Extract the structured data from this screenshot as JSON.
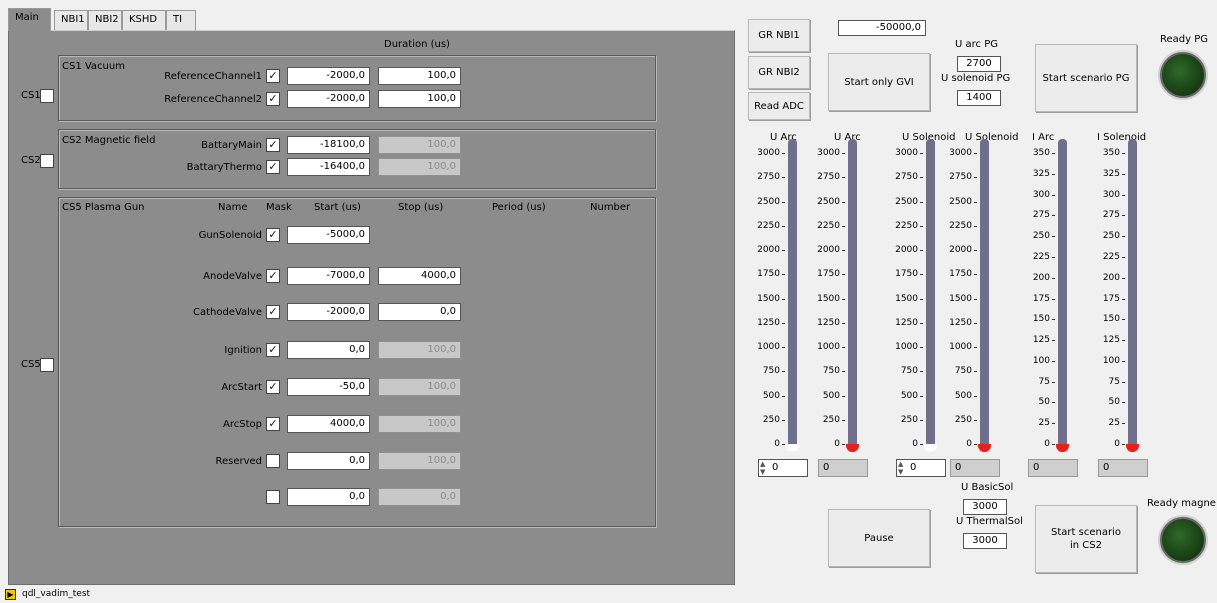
{
  "tabs": [
    "Main",
    "NBI1",
    "NBI2",
    "KSHD",
    "TI"
  ],
  "main": {
    "duration_header": "Duration (us)",
    "cs1": {
      "side_label": "CS1",
      "title": "CS1 Vacuum",
      "rows": [
        {
          "name": "ReferenceChannel1",
          "checked": "✓",
          "value": "-2000,0",
          "duration": "100,0"
        },
        {
          "name": "ReferenceChannel2",
          "checked": "✓",
          "value": "-2000,0",
          "duration": "100,0"
        }
      ]
    },
    "cs2": {
      "side_label": "CS2",
      "title": "CS2 Magnetic field",
      "rows": [
        {
          "name": "BattaryMain",
          "checked": "✓",
          "value": "-18100,0",
          "duration": "100,0"
        },
        {
          "name": "BattaryThermo",
          "checked": "✓",
          "value": "-16400,0",
          "duration": "100,0"
        }
      ]
    },
    "cs5": {
      "side_label": "CS5",
      "title": "CS5 Plasma Gun",
      "headers": {
        "name": "Name",
        "mask": "Mask",
        "start": "Start (us)",
        "stop": "Stop (us)",
        "period": "Period (us)",
        "number": "Number"
      },
      "rows": [
        {
          "name": "GunSolenoid",
          "checked": "✓",
          "start": "-5000,0",
          "stop": ""
        },
        {
          "name": "AnodeValve",
          "checked": "✓",
          "start": "-7000,0",
          "stop": "4000,0"
        },
        {
          "name": "CathodeValve",
          "checked": "✓",
          "start": "-2000,0",
          "stop": "0,0"
        },
        {
          "name": "Ignition",
          "checked": "✓",
          "start": "0,0",
          "stop": "100,0"
        },
        {
          "name": "ArcStart",
          "checked": "✓",
          "start": "-50,0",
          "stop": "100,0"
        },
        {
          "name": "ArcStop",
          "checked": "✓",
          "start": "4000,0",
          "stop": "100,0"
        },
        {
          "name": "Reserved",
          "checked": "",
          "start": "0,0",
          "stop": "100,0"
        },
        {
          "name": "",
          "checked": "",
          "start": "0,0",
          "stop": "0,0"
        }
      ]
    }
  },
  "right": {
    "gr_nbi1": "GR NBI1",
    "gr_nbi2": "GR NBI2",
    "read_adc": "Read ADC",
    "top_value": "-50000,0",
    "start_only_gvi": "Start only GVI",
    "u_arc_pg_label": "U arc PG",
    "u_arc_pg_value": "2700",
    "u_solenoid_pg_label": "U solenoid PG",
    "u_solenoid_pg_value": "1400",
    "start_scenario_pg": "Start scenario PG",
    "ready_pg": "Ready PG",
    "pause": "Pause",
    "u_basicsol_label": "U BasicSol",
    "u_basicsol_value": "3000",
    "u_thermalsol_label": "U ThermalSol",
    "u_thermalsol_value": "3000",
    "start_scenario_cs2": "Start scenario in CS2",
    "ready_magne": "Ready magne",
    "meters": [
      {
        "title": "U Arc",
        "ticks": [
          "3000",
          "2750",
          "2500",
          "2250",
          "2000",
          "1750",
          "1500",
          "1250",
          "1000",
          "750",
          "500",
          "250",
          "0"
        ],
        "value": "0",
        "control": true
      },
      {
        "title": "U Arc",
        "ticks": [
          "3000",
          "2750",
          "2500",
          "2250",
          "2000",
          "1750",
          "1500",
          "1250",
          "1000",
          "750",
          "500",
          "250",
          "0"
        ],
        "value": "0",
        "control": false
      },
      {
        "title": "U Solenoid",
        "ticks": [
          "3000",
          "2750",
          "2500",
          "2250",
          "2000",
          "1750",
          "1500",
          "1250",
          "1000",
          "750",
          "500",
          "250",
          "0"
        ],
        "value": "0",
        "control": true
      },
      {
        "title": "U Solenoid",
        "ticks": [
          "3000",
          "2750",
          "2500",
          "2250",
          "2000",
          "1750",
          "1500",
          "1250",
          "1000",
          "750",
          "500",
          "250",
          "0"
        ],
        "value": "0",
        "control": false
      },
      {
        "title": "I Arc",
        "ticks": [
          "350",
          "325",
          "300",
          "275",
          "250",
          "225",
          "200",
          "175",
          "150",
          "125",
          "100",
          "75",
          "50",
          "25",
          "0"
        ],
        "value": "0",
        "control": false
      },
      {
        "title": "I Solenoid",
        "ticks": [
          "350",
          "325",
          "300",
          "275",
          "250",
          "225",
          "200",
          "175",
          "150",
          "125",
          "100",
          "75",
          "50",
          "25",
          "0"
        ],
        "value": "0",
        "control": false
      }
    ]
  },
  "status": {
    "vi_name": "qdl_vadim_test",
    "icon": "vi-icon"
  },
  "colors": {
    "panel": "#8c8c8c",
    "lamp_off": "#1e4a1a",
    "meter_tube": "#6f6f8c",
    "meter_red": "#e8201c",
    "meter_blue": "#2050d0"
  }
}
